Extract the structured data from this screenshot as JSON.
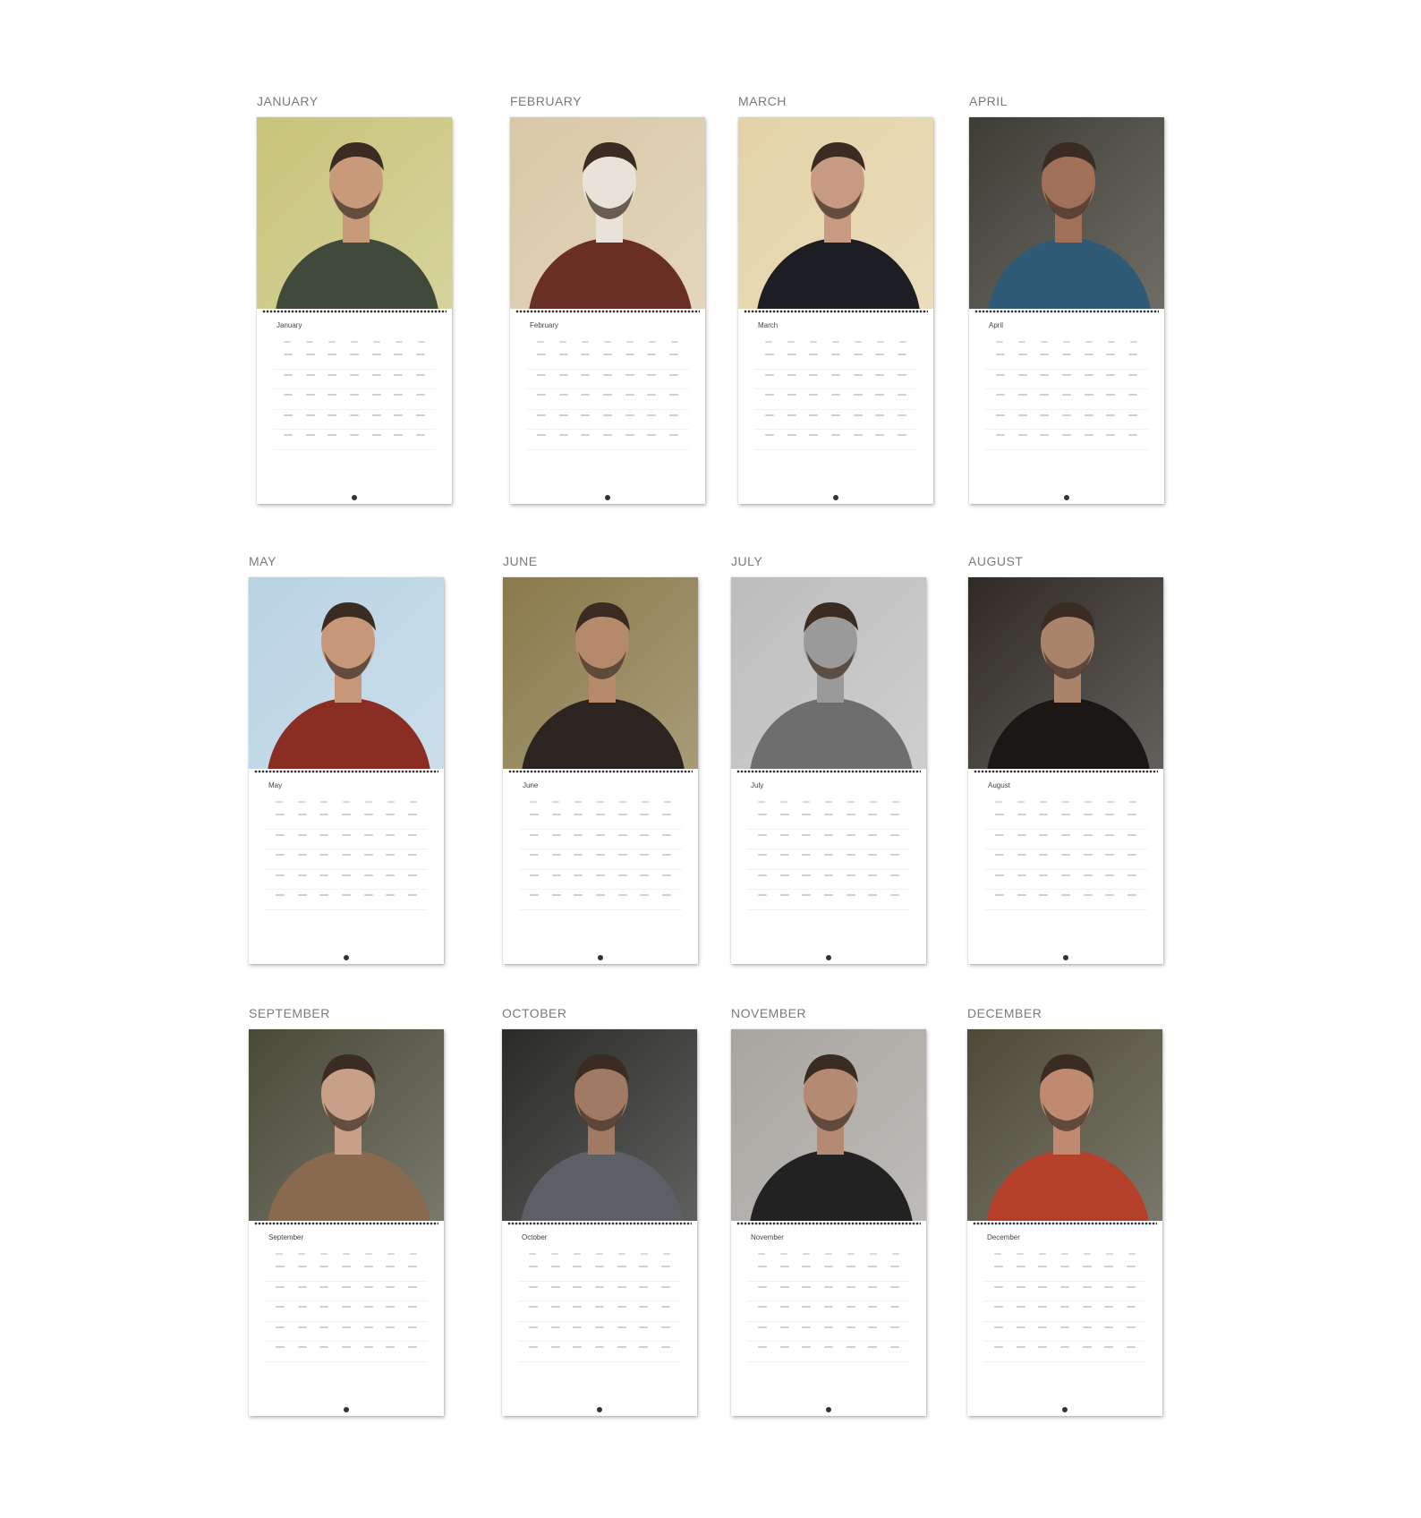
{
  "months": [
    {
      "label": "JANUARY",
      "grid_label": "January"
    },
    {
      "label": "FEBRUARY",
      "grid_label": "February"
    },
    {
      "label": "MARCH",
      "grid_label": "March"
    },
    {
      "label": "APRIL",
      "grid_label": "April"
    },
    {
      "label": "MAY",
      "grid_label": "May"
    },
    {
      "label": "JUNE",
      "grid_label": "June"
    },
    {
      "label": "JULY",
      "grid_label": "July"
    },
    {
      "label": "AUGUST",
      "grid_label": "August"
    },
    {
      "label": "SEPTEMBER",
      "grid_label": "September"
    },
    {
      "label": "OCTOBER",
      "grid_label": "October"
    },
    {
      "label": "NOVEMBER",
      "grid_label": "November"
    },
    {
      "label": "DECEMBER",
      "grid_label": "December"
    }
  ],
  "photo_palettes": {
    "0": [
      "#c8c47a",
      "#3f4a3a",
      "#c99a7a"
    ],
    "1": [
      "#d9c8a6",
      "#6a2f24",
      "#e8e3d8"
    ],
    "2": [
      "#e3d2a6",
      "#1d1d24",
      "#c69b82"
    ],
    "3": [
      "#3d3d34",
      "#2e5a75",
      "#a07058"
    ],
    "4": [
      "#b9d3e3",
      "#8a2d22",
      "#c79779"
    ],
    "5": [
      "#8a7a4a",
      "#2b2420",
      "#b58a6a"
    ],
    "6": [
      "#bdbdbd",
      "#6e6e6e",
      "#9a9a9a"
    ],
    "7": [
      "#2f2a24",
      "#1a1714",
      "#a9836a"
    ],
    "8": [
      "#4a4a3a",
      "#8a6a4e",
      "#c8a088"
    ],
    "9": [
      "#2a2a28",
      "#5c5f66",
      "#a07a62"
    ],
    "10": [
      "#a8a5a0",
      "#222222",
      "#b58a72"
    ],
    "11": [
      "#4d4a38",
      "#b5402a",
      "#c08a70"
    ]
  }
}
